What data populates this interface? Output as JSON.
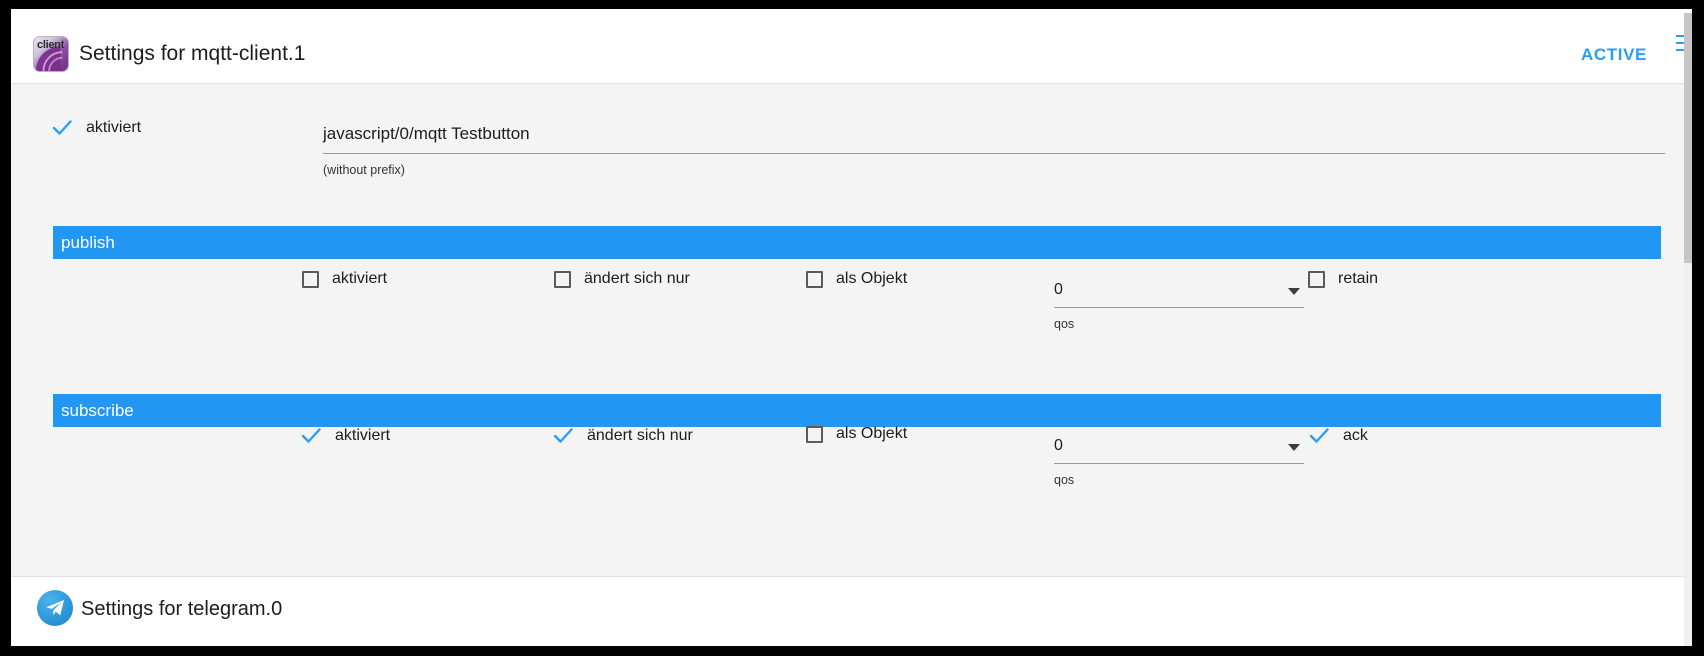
{
  "header": {
    "title": "Settings for mqtt-client.1",
    "status": "ACTIVE",
    "icon_name": "mqtt-client-icon",
    "icon_text": "client"
  },
  "enabled_row": {
    "checked": true,
    "label": "aktiviert"
  },
  "topic": {
    "value": "javascript/0/mqtt Testbutton",
    "hint": "(without prefix)"
  },
  "sections": [
    {
      "title": "publish",
      "options": [
        {
          "label": "aktiviert",
          "checked": false
        },
        {
          "label": "ändert sich nur",
          "checked": false
        },
        {
          "label": "als Objekt",
          "checked": false
        }
      ],
      "qos": {
        "value": "0",
        "label": "qos"
      },
      "flag": {
        "label": "retain",
        "checked": false
      }
    },
    {
      "title": "subscribe",
      "options": [
        {
          "label": "aktiviert",
          "checked": true
        },
        {
          "label": "ändert sich nur",
          "checked": true
        },
        {
          "label": "als Objekt",
          "checked": false
        }
      ],
      "qos": {
        "value": "0",
        "label": "qos"
      },
      "flag": {
        "label": "ack",
        "checked": true
      }
    }
  ],
  "footer": {
    "title": "Settings for telegram.0",
    "icon_name": "telegram-icon"
  },
  "colors": {
    "accent": "#2196f3",
    "active": "#2a9df4",
    "body_bg": "#f4f4f4"
  }
}
